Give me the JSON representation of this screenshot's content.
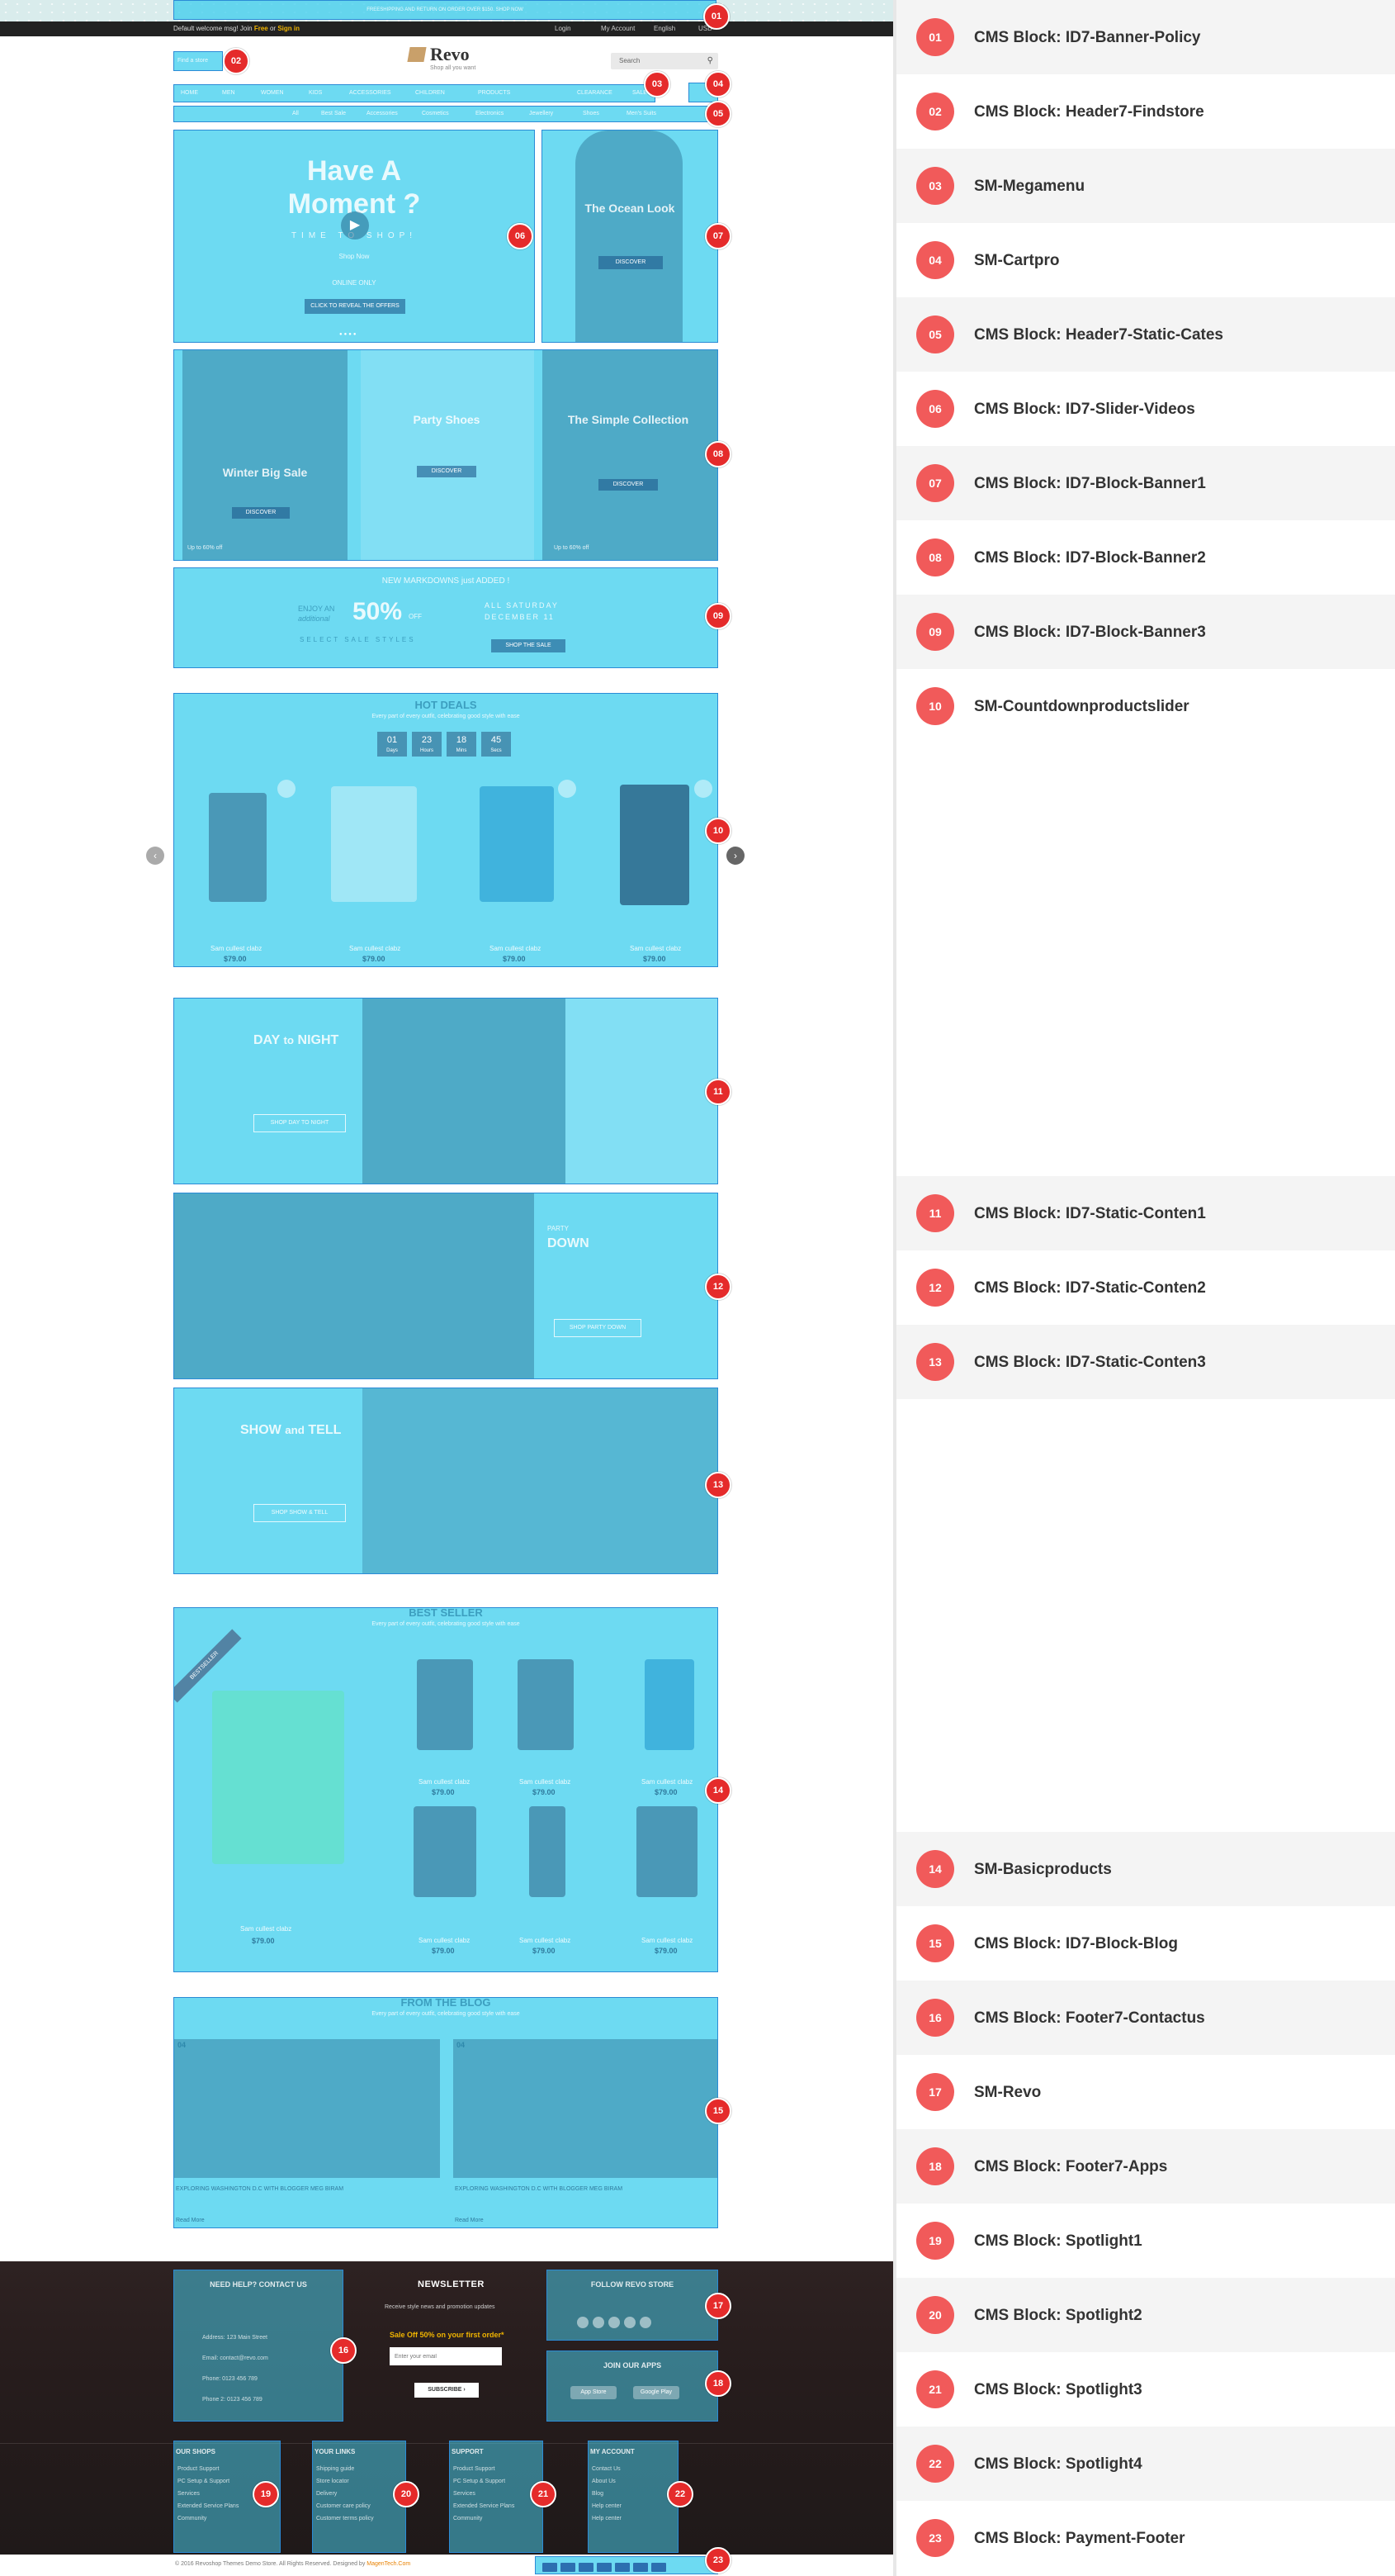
{
  "topbar": {
    "policy_text": "FREESHIPPING AND RETURN ON ORDER OVER $150. SHOP NOW",
    "welcome": "Default welcome msg! Join",
    "free_word": "Free",
    "or_word": "or",
    "signin_word": "Sign in",
    "login": "Login",
    "my_account": "My Account",
    "language": "English",
    "currency": "USD"
  },
  "header": {
    "findstore": "Find a store",
    "logo_name": "Revo",
    "logo_tag": "Shop all you want",
    "search_placeholder": "Search",
    "menu": [
      "HOME",
      "MEN",
      "WOMEN",
      "KIDS",
      "ACCESSORIES",
      "CHILDREN",
      "PRODUCTS",
      "CLEARANCE",
      "SALE"
    ],
    "static_cates": [
      "All",
      "Best Sale",
      "Accessories",
      "Cosmetics",
      "Electronics",
      "Jewellery",
      "Shoes",
      "Men's Suits"
    ]
  },
  "slider": {
    "title1": "Have A",
    "title2": "Moment ?",
    "line": "TIME TO SHOP!",
    "sub": "Shop Now",
    "online": "ONLINE ONLY",
    "button": "CLICK TO REVEAL THE OFFERS"
  },
  "banner1": {
    "title": "The Ocean Look",
    "button": "DISCOVER"
  },
  "banner2": [
    {
      "title": "Winter Big Sale",
      "button": "DISCOVER",
      "note": "Up to 60% off"
    },
    {
      "title": "Party Shoes",
      "button": "DISCOVER",
      "note": ""
    },
    {
      "title": "The Simple Collection",
      "button": "DISCOVER",
      "note": "Up to 60% off"
    }
  ],
  "banner3": {
    "headline": "NEW MARKDOWNS just ADDED !",
    "enjoy": "ENJOY AN",
    "additional": "additional",
    "percent": "50%",
    "off": "OFF",
    "select": "SELECT SALE STYLES",
    "saturday": "ALL SATURDAY",
    "date": "DECEMBER 11",
    "button": "SHOP THE SALE"
  },
  "hotdeals": {
    "title": "HOT DEALS",
    "subtitle": "Every part of every outfit, celebrating good style with ease",
    "countdown": [
      {
        "num": "01",
        "unit": "Days"
      },
      {
        "num": "23",
        "unit": "Hours"
      },
      {
        "num": "18",
        "unit": "Mins"
      },
      {
        "num": "45",
        "unit": "Secs"
      }
    ],
    "products": [
      {
        "name": "Sam cullest clabz",
        "price": "$79.00"
      },
      {
        "name": "Sam cullest clabz",
        "price": "$79.00"
      },
      {
        "name": "Sam cullest clabz",
        "price": "$79.00"
      },
      {
        "name": "Sam cullest clabz",
        "price": "$79.00"
      }
    ]
  },
  "content1": {
    "title_a": "DAY",
    "title_b": "to",
    "title_c": "NIGHT",
    "button": "SHOP DAY TO NIGHT"
  },
  "content2": {
    "small": "PARTY",
    "title": "DOWN",
    "button": "SHOP PARTY DOWN"
  },
  "content3": {
    "title_a": "SHOW",
    "title_b": "and",
    "title_c": "TELL",
    "button": "SHOP SHOW & TELL"
  },
  "bestseller": {
    "title": "BEST SELLER",
    "subtitle": "Every part of every outfit, celebrating good style with ease",
    "ribbon": "BESTSELLER",
    "products": [
      {
        "name": "Sam cullest clabz",
        "price": "$79.00"
      },
      {
        "name": "Sam cullest clabz",
        "price": "$79.00"
      },
      {
        "name": "Sam cullest clabz",
        "price": "$79.00"
      },
      {
        "name": "Sam cullest clabz",
        "price": "$79.00"
      },
      {
        "name": "Sam cullest clabz",
        "price": "$79.00"
      },
      {
        "name": "Sam cullest clabz",
        "price": "$79.00"
      },
      {
        "name": "Sam cullest clabz",
        "price": "$79.00"
      }
    ]
  },
  "blog": {
    "title": "FROM THE BLOG",
    "subtitle": "Every part of every outfit, celebrating good style with ease",
    "posts": [
      {
        "date": "04",
        "title": "EXPLORING WASHINGTON D.C WITH BLOGGER MEG BIRAM",
        "more": "Read More"
      },
      {
        "date": "04",
        "title": "EXPLORING WASHINGTON D.C WITH BLOGGER MEG BIRAM",
        "more": "Read More"
      }
    ]
  },
  "footer": {
    "contact_title": "NEED HELP? CONTACT US",
    "contact_lines": [
      "Address: 123 Main Street",
      "Email: contact@revo.com",
      "Phone: 0123 456 789",
      "Phone 2: 0123 456 789"
    ],
    "newsletter_title": "NEWSLETTER",
    "newsletter_sub": "Receive style news and promotion updates",
    "newsletter_off": "Sale Off 50% on your first order*",
    "newsletter_placeholder": "Enter your email",
    "newsletter_button": "SUBSCRIBE",
    "follow_title": "FOLLOW REVO STORE",
    "apps_title": "JOIN OUR APPS",
    "app_store": "App Store",
    "google_play": "Google Play",
    "spotlights": [
      {
        "title": "OUR SHOPS",
        "items": [
          "Product Support",
          "PC Setup & Support",
          "Services",
          "Extended Service Plans",
          "Community"
        ]
      },
      {
        "title": "YOUR LINKS",
        "items": [
          "Shipping guide",
          "Store locator",
          "Delivery",
          "Customer care policy",
          "Customer terms policy"
        ]
      },
      {
        "title": "SUPPORT",
        "items": [
          "Product Support",
          "PC Setup & Support",
          "Services",
          "Extended Service Plans",
          "Community"
        ]
      },
      {
        "title": "MY ACCOUNT",
        "items": [
          "Contact Us",
          "About Us",
          "Blog",
          "Help center",
          "Help center"
        ]
      }
    ],
    "copyright": "© 2016 Revoshop Themes Demo Store. All Rights Reserved. Designed by",
    "copyright_link": "MagenTech.Com"
  },
  "markers": [
    "01",
    "02",
    "03",
    "04",
    "05",
    "06",
    "07",
    "08",
    "09",
    "10",
    "11",
    "12",
    "13",
    "14",
    "15",
    "16",
    "17",
    "18",
    "19",
    "20",
    "21",
    "22",
    "23"
  ],
  "legend": [
    {
      "num": "01",
      "label": "CMS Block: ID7-Banner-Policy"
    },
    {
      "num": "02",
      "label": "CMS Block: Header7-Findstore"
    },
    {
      "num": "03",
      "label": "SM-Megamenu"
    },
    {
      "num": "04",
      "label": "SM-Cartpro"
    },
    {
      "num": "05",
      "label": "CMS Block: Header7-Static-Cates"
    },
    {
      "num": "06",
      "label": "CMS Block: ID7-Slider-Videos"
    },
    {
      "num": "07",
      "label": "CMS Block: ID7-Block-Banner1"
    },
    {
      "num": "08",
      "label": "CMS Block: ID7-Block-Banner2"
    },
    {
      "num": "09",
      "label": "CMS Block: ID7-Block-Banner3"
    },
    {
      "num": "10",
      "label": "SM-Countdownproductslider"
    },
    {
      "num": "11",
      "label": "CMS Block: ID7-Static-Conten1"
    },
    {
      "num": "12",
      "label": "CMS Block: ID7-Static-Conten2"
    },
    {
      "num": "13",
      "label": "CMS Block: ID7-Static-Conten3"
    },
    {
      "num": "14",
      "label": "SM-Basicproducts"
    },
    {
      "num": "15",
      "label": "CMS Block: ID7-Block-Blog"
    },
    {
      "num": "16",
      "label": "CMS Block: Footer7-Contactus"
    },
    {
      "num": "17",
      "label": "SM-Revo"
    },
    {
      "num": "18",
      "label": "CMS Block: Footer7-Apps"
    },
    {
      "num": "19",
      "label": "CMS Block: Spotlight1"
    },
    {
      "num": "20",
      "label": "CMS Block: Spotlight2"
    },
    {
      "num": "21",
      "label": "CMS Block: Spotlight3"
    },
    {
      "num": "22",
      "label": "CMS Block: Spotlight4"
    },
    {
      "num": "23",
      "label": "CMS Block: Payment-Footer"
    }
  ],
  "colors": {
    "overlay": "#3ccdee",
    "marker": "#e52b2b",
    "badge": "#f15a5a",
    "footer_bg": "#2a1f1f"
  }
}
